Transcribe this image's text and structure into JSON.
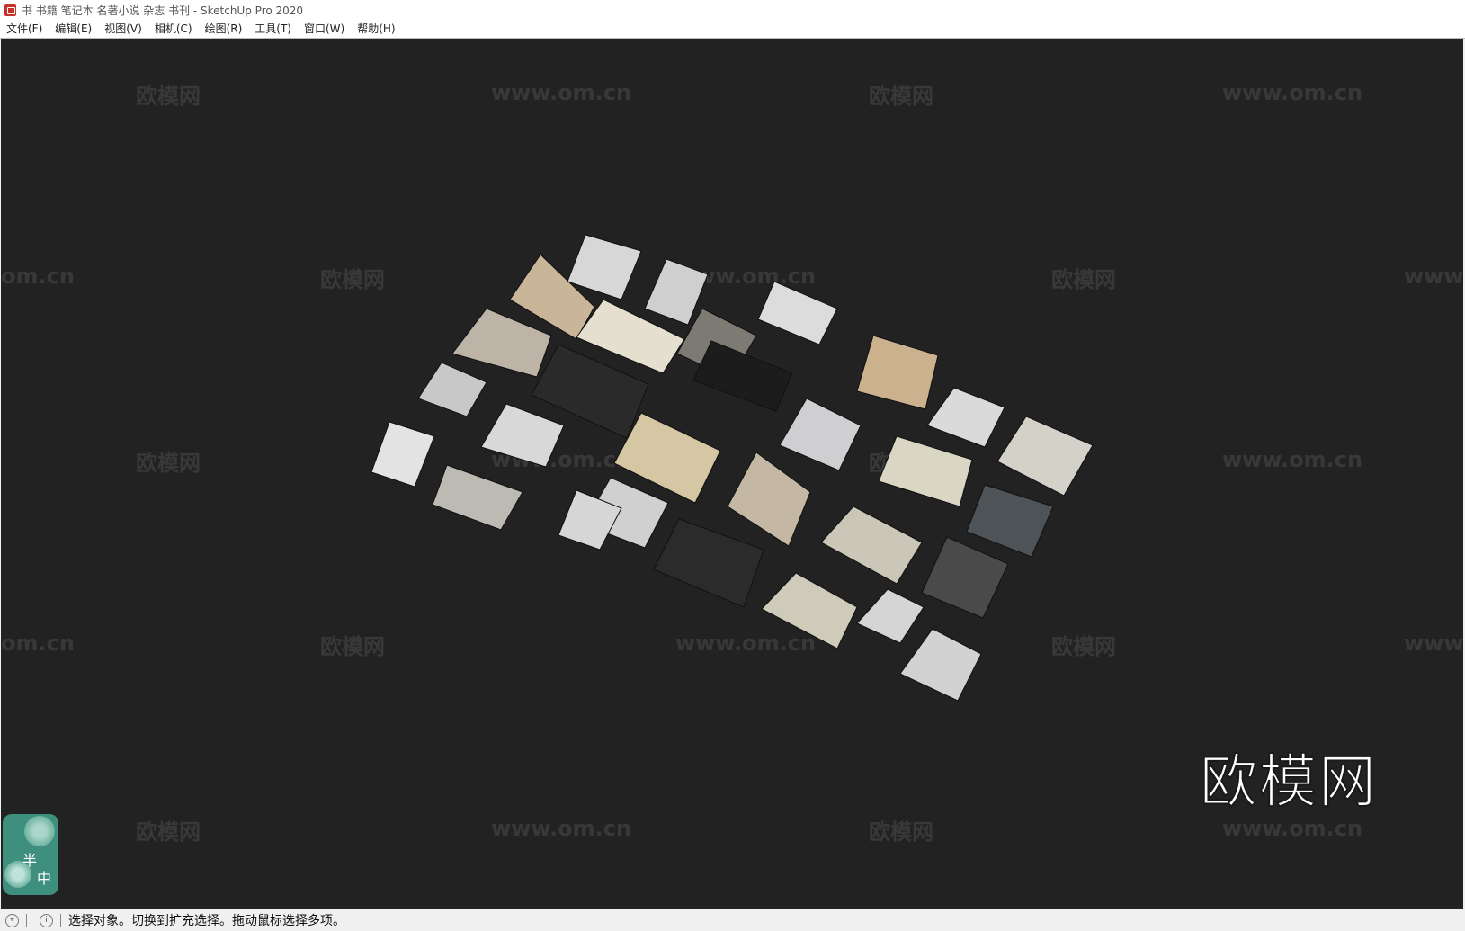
{
  "window": {
    "title": "书 书籍 笔记本 名著小说 杂志 书刊 - SketchUp Pro 2020"
  },
  "menu": [
    "文件(F)",
    "编辑(E)",
    "视图(V)",
    "相机(C)",
    "绘图(R)",
    "工具(T)",
    "窗口(W)",
    "帮助(H)"
  ],
  "watermarks": {
    "brand_cn": "欧模网",
    "domain": "www.om.cn",
    "domain_left": "om.cn",
    "domain_right": "www.",
    "big": "欧模网"
  },
  "ime": {
    "char1": "半",
    "char2": "中"
  },
  "status": {
    "text": "选择对象。切换到扩充选择。拖动鼠标选择多项。"
  },
  "colors": {
    "viewport_bg": "#222222",
    "menubar_bg": "#ffffff",
    "statusbar_bg": "#f0f0f0"
  }
}
